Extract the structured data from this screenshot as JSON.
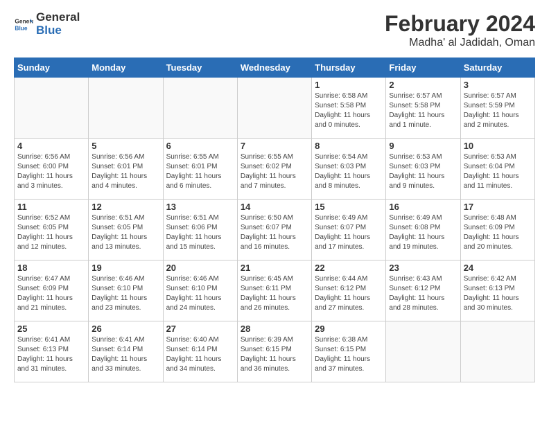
{
  "header": {
    "logo_general": "General",
    "logo_blue": "Blue",
    "month_title": "February 2024",
    "location": "Madha' al Jadidah, Oman"
  },
  "weekdays": [
    "Sunday",
    "Monday",
    "Tuesday",
    "Wednesday",
    "Thursday",
    "Friday",
    "Saturday"
  ],
  "weeks": [
    [
      {
        "day": "",
        "info": ""
      },
      {
        "day": "",
        "info": ""
      },
      {
        "day": "",
        "info": ""
      },
      {
        "day": "",
        "info": ""
      },
      {
        "day": "1",
        "info": "Sunrise: 6:58 AM\nSunset: 5:58 PM\nDaylight: 11 hours and 0 minutes."
      },
      {
        "day": "2",
        "info": "Sunrise: 6:57 AM\nSunset: 5:58 PM\nDaylight: 11 hours and 1 minute."
      },
      {
        "day": "3",
        "info": "Sunrise: 6:57 AM\nSunset: 5:59 PM\nDaylight: 11 hours and 2 minutes."
      }
    ],
    [
      {
        "day": "4",
        "info": "Sunrise: 6:56 AM\nSunset: 6:00 PM\nDaylight: 11 hours and 3 minutes."
      },
      {
        "day": "5",
        "info": "Sunrise: 6:56 AM\nSunset: 6:01 PM\nDaylight: 11 hours and 4 minutes."
      },
      {
        "day": "6",
        "info": "Sunrise: 6:55 AM\nSunset: 6:01 PM\nDaylight: 11 hours and 6 minutes."
      },
      {
        "day": "7",
        "info": "Sunrise: 6:55 AM\nSunset: 6:02 PM\nDaylight: 11 hours and 7 minutes."
      },
      {
        "day": "8",
        "info": "Sunrise: 6:54 AM\nSunset: 6:03 PM\nDaylight: 11 hours and 8 minutes."
      },
      {
        "day": "9",
        "info": "Sunrise: 6:53 AM\nSunset: 6:03 PM\nDaylight: 11 hours and 9 minutes."
      },
      {
        "day": "10",
        "info": "Sunrise: 6:53 AM\nSunset: 6:04 PM\nDaylight: 11 hours and 11 minutes."
      }
    ],
    [
      {
        "day": "11",
        "info": "Sunrise: 6:52 AM\nSunset: 6:05 PM\nDaylight: 11 hours and 12 minutes."
      },
      {
        "day": "12",
        "info": "Sunrise: 6:51 AM\nSunset: 6:05 PM\nDaylight: 11 hours and 13 minutes."
      },
      {
        "day": "13",
        "info": "Sunrise: 6:51 AM\nSunset: 6:06 PM\nDaylight: 11 hours and 15 minutes."
      },
      {
        "day": "14",
        "info": "Sunrise: 6:50 AM\nSunset: 6:07 PM\nDaylight: 11 hours and 16 minutes."
      },
      {
        "day": "15",
        "info": "Sunrise: 6:49 AM\nSunset: 6:07 PM\nDaylight: 11 hours and 17 minutes."
      },
      {
        "day": "16",
        "info": "Sunrise: 6:49 AM\nSunset: 6:08 PM\nDaylight: 11 hours and 19 minutes."
      },
      {
        "day": "17",
        "info": "Sunrise: 6:48 AM\nSunset: 6:09 PM\nDaylight: 11 hours and 20 minutes."
      }
    ],
    [
      {
        "day": "18",
        "info": "Sunrise: 6:47 AM\nSunset: 6:09 PM\nDaylight: 11 hours and 21 minutes."
      },
      {
        "day": "19",
        "info": "Sunrise: 6:46 AM\nSunset: 6:10 PM\nDaylight: 11 hours and 23 minutes."
      },
      {
        "day": "20",
        "info": "Sunrise: 6:46 AM\nSunset: 6:10 PM\nDaylight: 11 hours and 24 minutes."
      },
      {
        "day": "21",
        "info": "Sunrise: 6:45 AM\nSunset: 6:11 PM\nDaylight: 11 hours and 26 minutes."
      },
      {
        "day": "22",
        "info": "Sunrise: 6:44 AM\nSunset: 6:12 PM\nDaylight: 11 hours and 27 minutes."
      },
      {
        "day": "23",
        "info": "Sunrise: 6:43 AM\nSunset: 6:12 PM\nDaylight: 11 hours and 28 minutes."
      },
      {
        "day": "24",
        "info": "Sunrise: 6:42 AM\nSunset: 6:13 PM\nDaylight: 11 hours and 30 minutes."
      }
    ],
    [
      {
        "day": "25",
        "info": "Sunrise: 6:41 AM\nSunset: 6:13 PM\nDaylight: 11 hours and 31 minutes."
      },
      {
        "day": "26",
        "info": "Sunrise: 6:41 AM\nSunset: 6:14 PM\nDaylight: 11 hours and 33 minutes."
      },
      {
        "day": "27",
        "info": "Sunrise: 6:40 AM\nSunset: 6:14 PM\nDaylight: 11 hours and 34 minutes."
      },
      {
        "day": "28",
        "info": "Sunrise: 6:39 AM\nSunset: 6:15 PM\nDaylight: 11 hours and 36 minutes."
      },
      {
        "day": "29",
        "info": "Sunrise: 6:38 AM\nSunset: 6:15 PM\nDaylight: 11 hours and 37 minutes."
      },
      {
        "day": "",
        "info": ""
      },
      {
        "day": "",
        "info": ""
      }
    ]
  ]
}
